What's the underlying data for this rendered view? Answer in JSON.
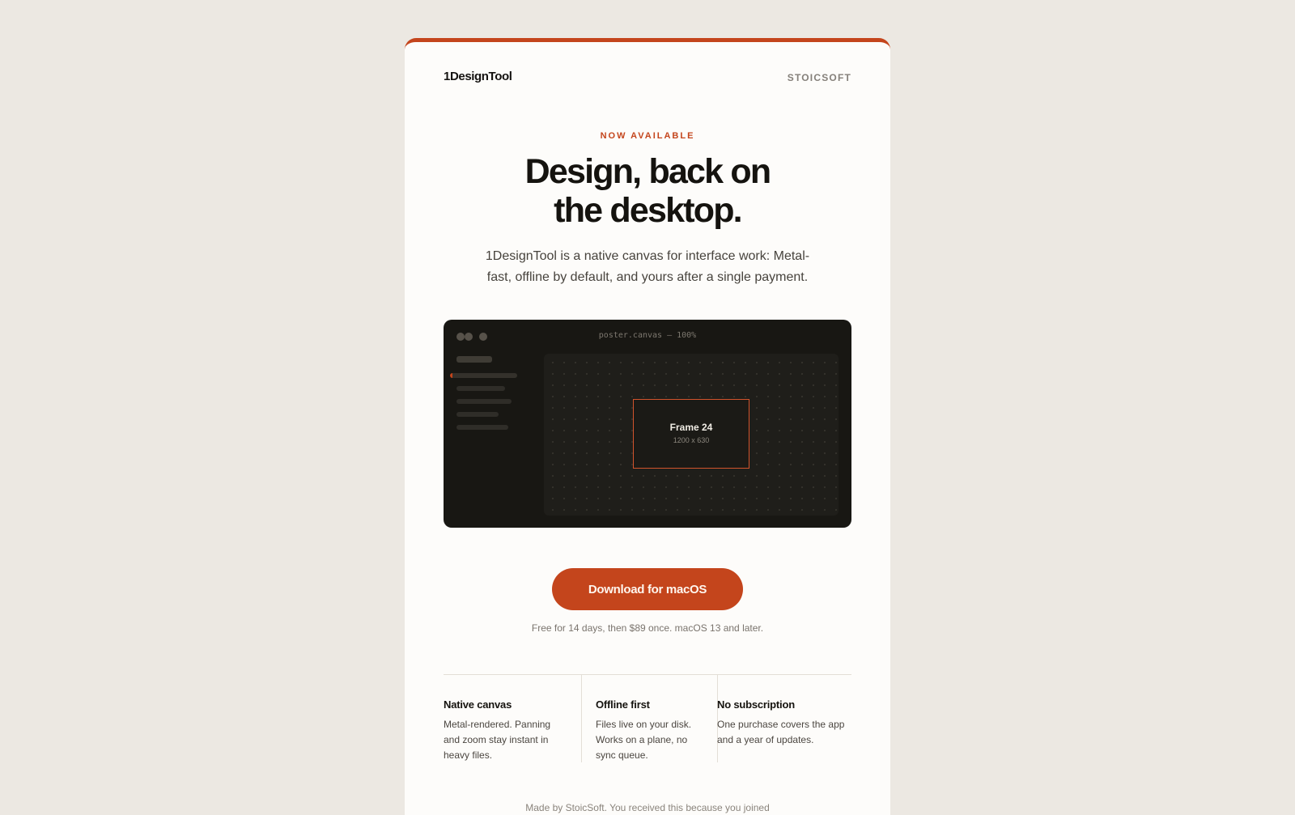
{
  "header": {
    "brand": "1DesignTool",
    "company": "STOICSOFT"
  },
  "hero": {
    "eyebrow": "NOW AVAILABLE",
    "headline_line1": "Design, back on",
    "headline_line2": "the desktop.",
    "lede": "1DesignTool is a native canvas for interface work: Metal-fast, offline by default, and yours after a single payment."
  },
  "preview": {
    "window_title": "poster.canvas — 100%",
    "frame_name": "Frame 24",
    "frame_size": "1200 x 630"
  },
  "cta": {
    "label": "Download for macOS",
    "fine_print": "Free for 14 days, then $89 once. macOS 13 and later."
  },
  "features": [
    {
      "title": "Native canvas",
      "body": "Metal-rendered. Panning and zoom stay instant in heavy files."
    },
    {
      "title": "Offline first",
      "body": "Files live on your disk. Works on a plane, no sync queue."
    },
    {
      "title": "No subscription",
      "body": "One purchase covers the app and a year of updates."
    }
  ],
  "footer": {
    "text": "Made by StoicSoft. You received this because you joined"
  },
  "colors": {
    "accent": "#c4451c",
    "page_bg": "#ece8e2",
    "card_bg": "#fdfcfa",
    "preview_bg": "#181713"
  }
}
